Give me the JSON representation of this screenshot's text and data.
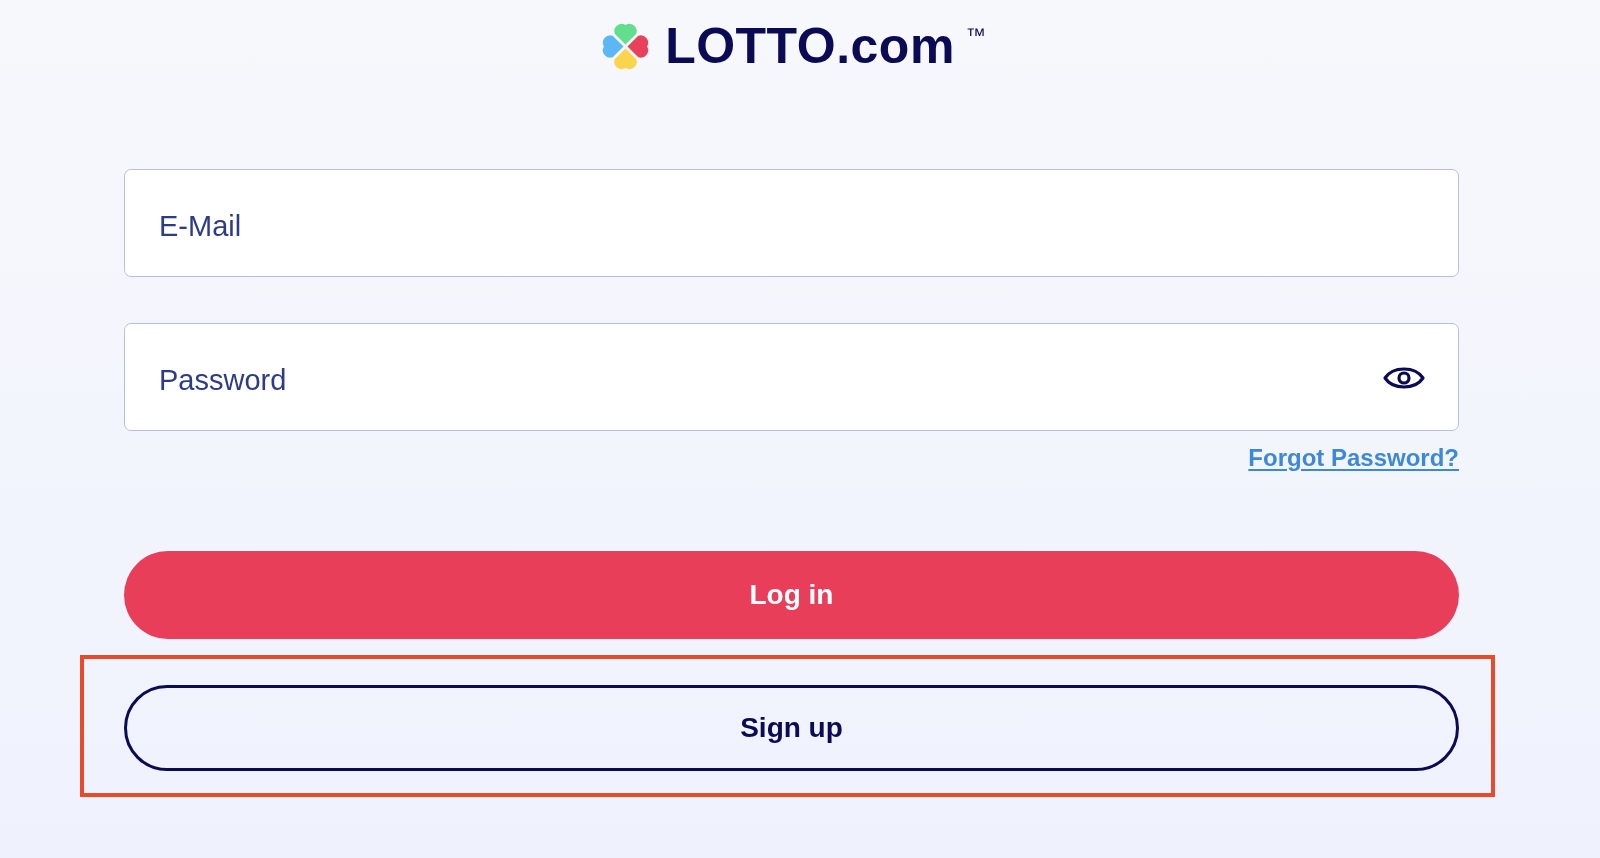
{
  "logo": {
    "text": "LOTTO.com",
    "trademark": "™"
  },
  "fields": [
    {
      "kind": "email",
      "placeholder": "E-Mail"
    },
    {
      "kind": "password",
      "placeholder": "Password"
    }
  ],
  "forgot_password_link": {
    "label": "Forgot Password?"
  },
  "buttons": [
    {
      "kind": "primary",
      "label": "Log in",
      "highlighted": false
    },
    {
      "kind": "outline",
      "label": "Sign up",
      "highlighted": true
    }
  ]
}
